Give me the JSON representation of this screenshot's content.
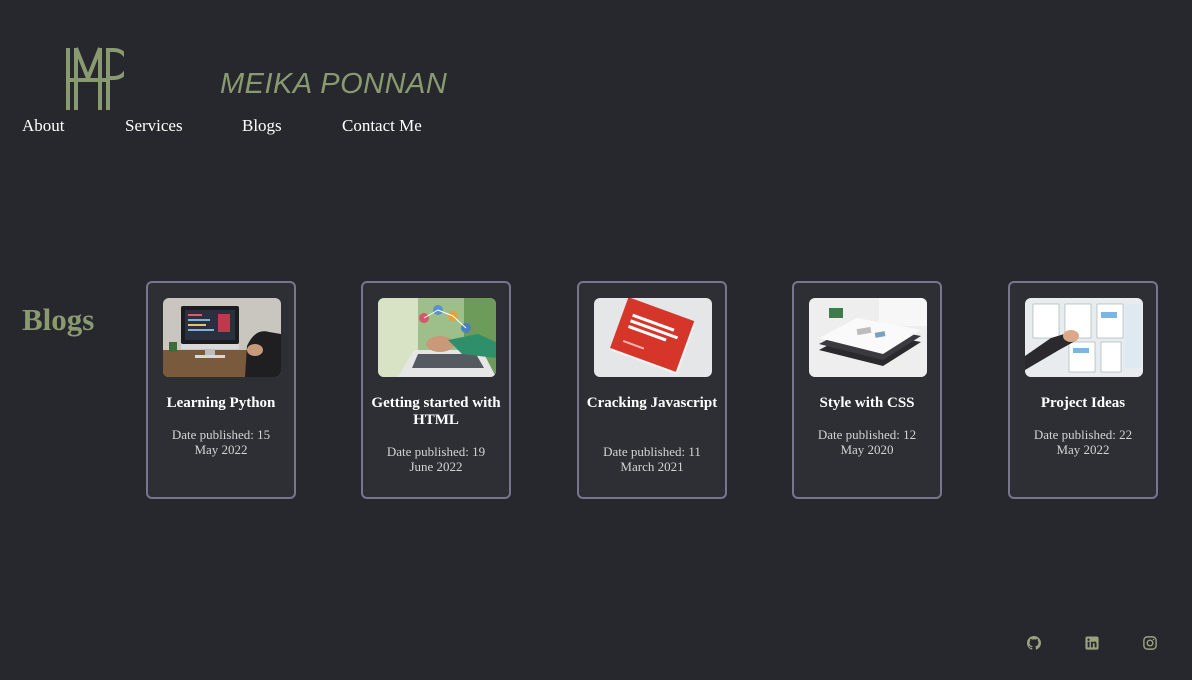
{
  "header": {
    "brand_name": "MEIKA PONNAN",
    "logo_icon": "mp-monogram-logo",
    "nav": [
      {
        "label": "About"
      },
      {
        "label": "Services"
      },
      {
        "label": "Blogs"
      },
      {
        "label": "Contact Me"
      }
    ]
  },
  "main": {
    "section_title": "Blogs",
    "cards": [
      {
        "title": "Learning Python",
        "date": "Date published: 15 May 2022",
        "image": "imac-code-desk-photo"
      },
      {
        "title": "Getting started with HTML",
        "date": "Date published: 19 June 2022",
        "image": "laptop-network-icons-photo"
      },
      {
        "title": "Cracking Javascript",
        "date": "Date published: 11 March 2021",
        "image": "red-javascript-book-photo"
      },
      {
        "title": "Style with CSS",
        "date": "Date published: 12 May 2020",
        "image": "books-stack-desk-photo"
      },
      {
        "title": "Project Ideas",
        "date": "Date published: 22 May 2022",
        "image": "wireframe-sketch-board-photo"
      }
    ]
  },
  "footer": {
    "social": [
      "github-icon",
      "linkedin-icon",
      "instagram-icon"
    ]
  },
  "colors": {
    "background": "#27282d",
    "accent": "#8a9a70",
    "card_border": "#76768c",
    "card_bg": "#2d2f34"
  }
}
